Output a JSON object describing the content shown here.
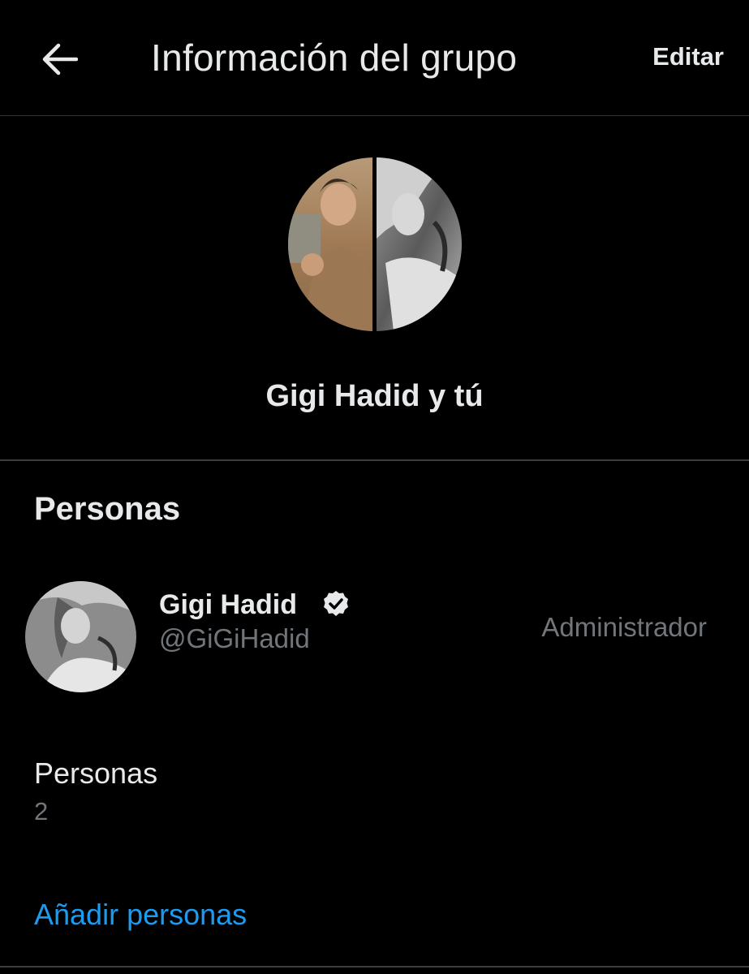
{
  "header": {
    "back_icon": "arrow-left-icon",
    "title": "Información del grupo",
    "edit_label": "Editar"
  },
  "group": {
    "avatar_icon": "group-avatar-split-photo",
    "name": "Gigi Hadid y tú"
  },
  "people_section": {
    "heading": "Personas",
    "members": [
      {
        "name": "Gigi Hadid",
        "handle": "@GiGiHadid",
        "role": "Administrador",
        "verified": true,
        "verified_icon": "verified-badge-icon"
      }
    ],
    "count_label": "Personas",
    "count_value": "2",
    "add_label": "Añadir personas"
  },
  "colors": {
    "background": "#000000",
    "primary_text": "#e7e9ea",
    "secondary_text": "#71767b",
    "link": "#1d9bf0",
    "divider": "#2f3336"
  }
}
